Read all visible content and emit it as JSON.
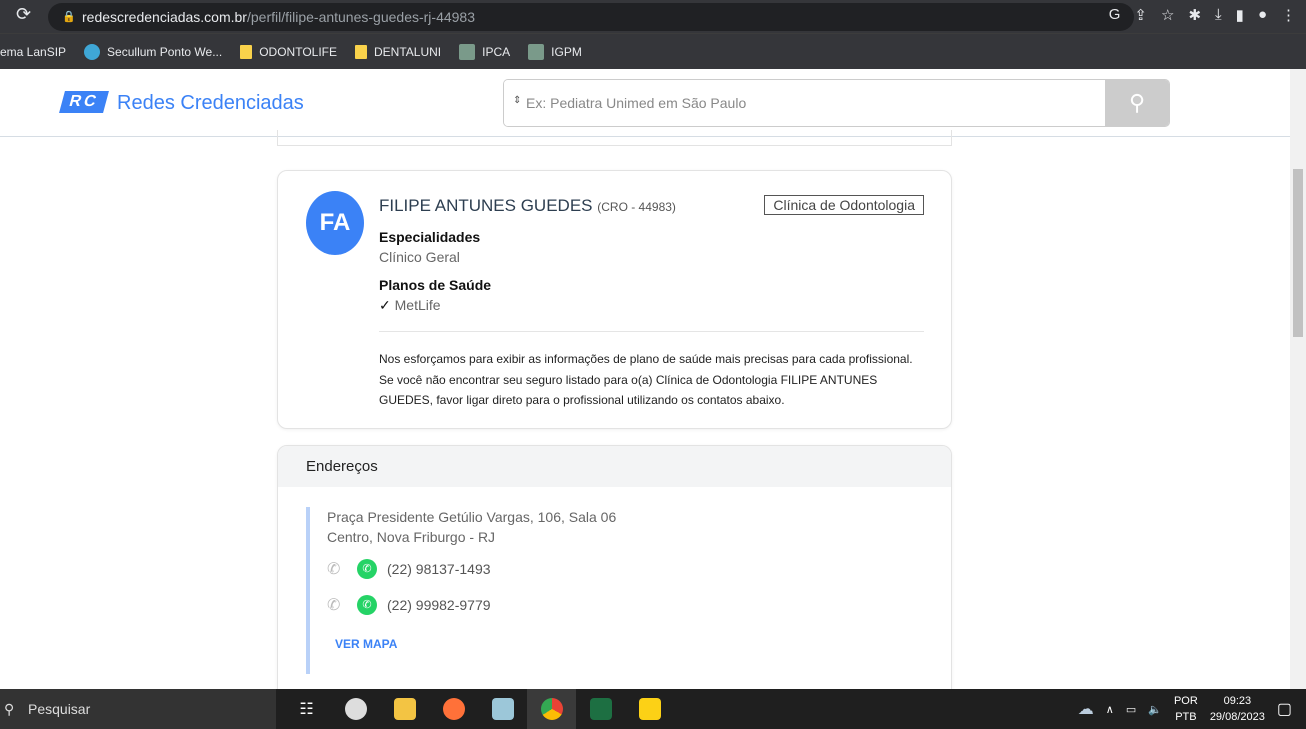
{
  "browser": {
    "url_host": "redescredenciadas.com.br",
    "url_path": "/perfil/filipe-antunes-guedes-rj-44983",
    "bookmarks": [
      "ema LanSIP",
      "Secullum Ponto We...",
      "ODONTOLIFE",
      "DENTALUNI",
      "IPCA",
      "IGPM"
    ]
  },
  "header": {
    "logo": "RC",
    "brand": "Redes Credenciadas",
    "search_placeholder": "Ex: Pediatra Unimed em São Paulo"
  },
  "profile": {
    "initials": "FA",
    "name": "FILIPE ANTUNES GUEDES",
    "registry": "(CRO - 44983)",
    "category": "Clínica de Odontologia",
    "specialties_label": "Especialidades",
    "specialty": "Clínico Geral",
    "plans_label": "Planos de Saúde",
    "plan": "MetLife",
    "note": "Nos esforçamos para exibir as informações de plano de saúde mais precisas para cada profissional. Se você não encontrar seu seguro listado para o(a) Clínica de Odontologia FILIPE ANTUNES GUEDES, favor ligar direto para o profissional utilizando os contatos abaixo."
  },
  "addresses": {
    "title": "Endereços",
    "line1": "Praça Presidente Getúlio Vargas, 106, Sala 06",
    "line2": "Centro, Nova Friburgo - RJ",
    "phones": [
      "(22) 98137-1493",
      "(22) 99982-9779"
    ],
    "map_link": "VER MAPA"
  },
  "taskbar": {
    "search": "Pesquisar",
    "lang1": "POR",
    "lang2": "PTB",
    "time": "09:23",
    "date": "29/08/2023"
  }
}
